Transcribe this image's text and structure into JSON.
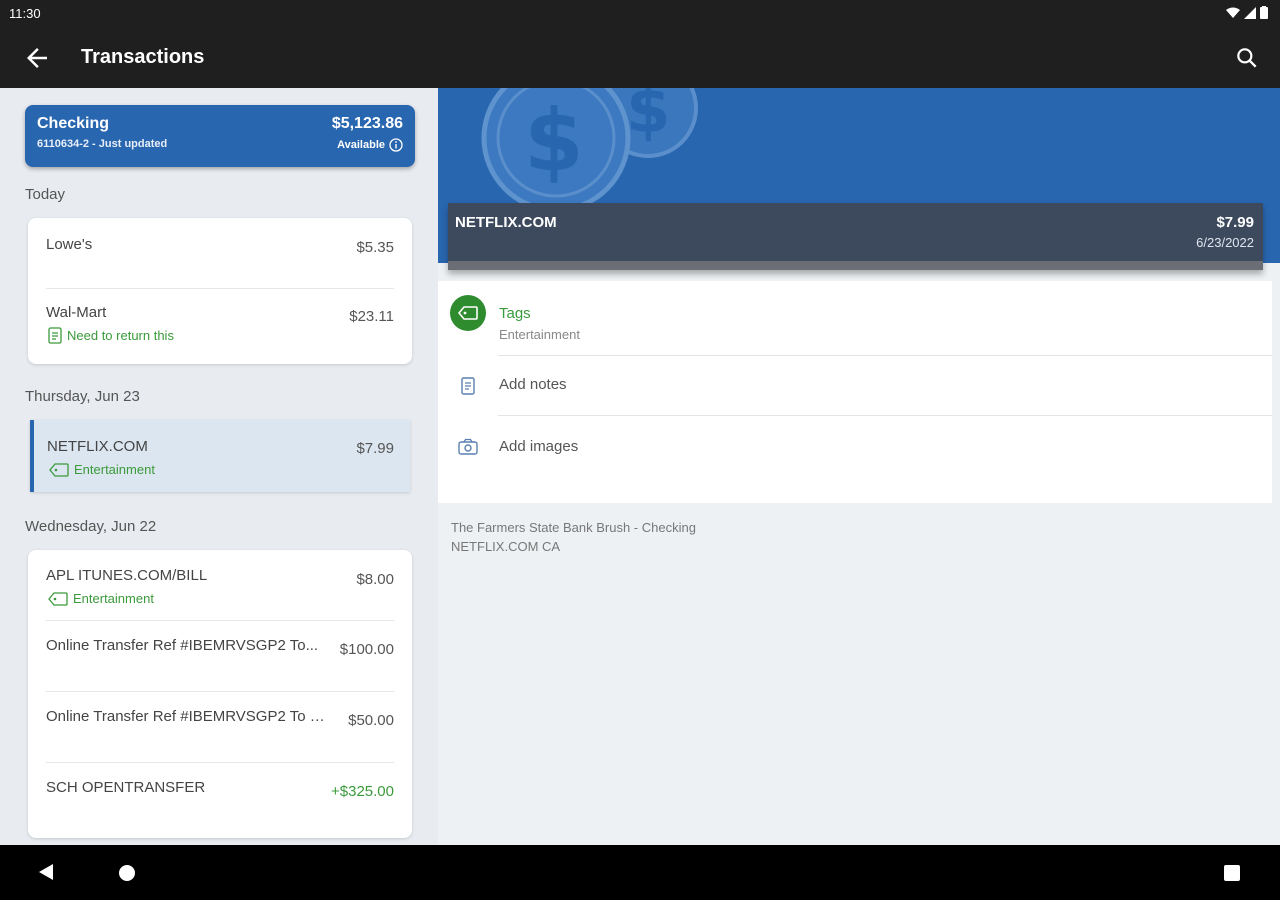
{
  "status_bar": {
    "time": "11:30"
  },
  "app_bar": {
    "title": "Transactions"
  },
  "account": {
    "name": "Checking",
    "subtitle": "6110634-2 - Just updated",
    "balance": "$5,123.86",
    "available_label": "Available"
  },
  "groups": [
    {
      "date": "Today",
      "transactions": [
        {
          "name": "Lowe's",
          "amount": "$5.35"
        },
        {
          "name": "Wal-Mart",
          "amount": "$23.11",
          "note": "Need to return this"
        }
      ]
    },
    {
      "date": "Thursday, Jun 23",
      "transactions": [
        {
          "name": "NETFLIX.COM",
          "amount": "$7.99",
          "tag": "Entertainment",
          "selected": true
        }
      ]
    },
    {
      "date": "Wednesday, Jun 22",
      "transactions": [
        {
          "name": "APL ITUNES.COM/BILL",
          "amount": "$8.00",
          "tag": "Entertainment"
        },
        {
          "name": "Online Transfer Ref #IBEMRVSGP2 To...",
          "amount": "$100.00"
        },
        {
          "name": "Online Transfer Ref #IBEMRVSGP2 To S...",
          "amount": "$50.00"
        },
        {
          "name": "SCH OPENTRANSFER",
          "amount": "+$325.00"
        }
      ]
    }
  ],
  "detail": {
    "merchant": "NETFLIX.COM",
    "amount": "$7.99",
    "date": "6/23/2022",
    "tags_label": "Tags",
    "tags_value": "Entertainment",
    "add_notes_label": "Add notes",
    "add_images_label": "Add images",
    "bank_line1": "The Farmers State Bank Brush - Checking",
    "bank_line2": "NETFLIX.COM CA"
  },
  "colors": {
    "primary": "#2966b0",
    "positive": "#3b9a3b",
    "appbar": "#1f1f1f"
  }
}
